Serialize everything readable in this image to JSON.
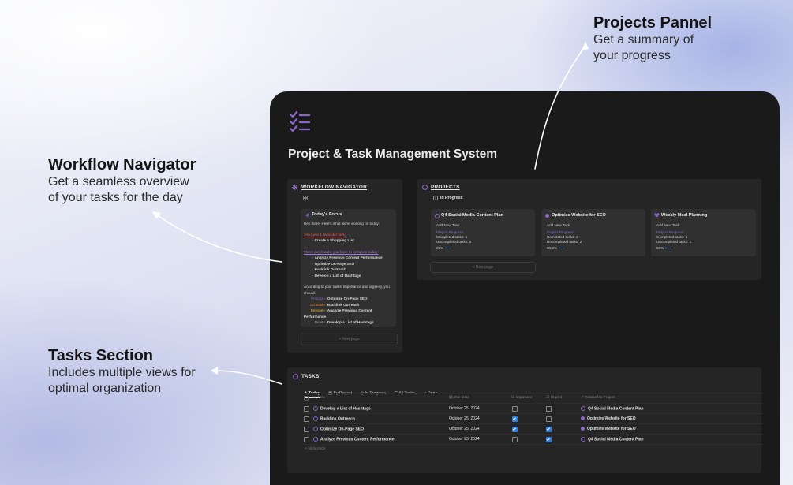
{
  "callouts": {
    "projects": {
      "heading": "Projects Pannel",
      "sub1": "Get a summary of",
      "sub2": "your progress"
    },
    "workflow": {
      "heading": "Workflow Navigator",
      "sub1": "Get a seamless overview",
      "sub2": "of your tasks for the day"
    },
    "tasks": {
      "heading": "Tasks Section",
      "sub1": "Includes multiple views for",
      "sub2": "optimal organization"
    }
  },
  "app": {
    "title": "Project & Task Management System",
    "accent": "#8a66c9"
  },
  "workflow": {
    "header": "WORKFLOW NAVIGATOR",
    "focus_title": "Today's Focus",
    "greeting": "Hey there! Here's what we're working on today:",
    "reminder_link": "You have 1 reminder task:",
    "reminder_item": "Create a Shopping List",
    "tasks_link": "There are 4 tasks you have to complete today:",
    "tasks": [
      "Analyze Previous Content Performance",
      "Optimize On-Page SEO",
      "Backlink Outreach",
      "Develop a List of Hashtags"
    ],
    "advice1": "According to your tasks' importance and urgency, you",
    "advice2": "should:",
    "prioritize_label": "Prioritize",
    "prioritize_item": "Optimize On-Page SEO",
    "schedule_label": "Schedule",
    "schedule_item": "Backlink Outreach",
    "delegate_label": "Delegate",
    "delegate_item": "Analyze Previous Content",
    "delegate_item_cont": "Performance",
    "delete_label": "Delete",
    "delete_item": "Develop a List of Hashtags",
    "new_page": "+ New page"
  },
  "projects": {
    "header": "PROJECTS",
    "view": "In Progress",
    "new_page": "+ New page",
    "cards": [
      {
        "name": "Q4 Social Media Content Plan",
        "add": "Add New Task",
        "progress_label": "Project Progress:",
        "completed": "Completed tasks: 1",
        "uncompleted": "Uncompleted tasks: 3",
        "pct": "25%"
      },
      {
        "name": "Optimize Website for SEO",
        "add": "Add New Task",
        "progress_label": "Project Progress:",
        "completed": "Completed tasks: 1",
        "uncompleted": "Uncompleted tasks: 2",
        "pct": "33.3%"
      },
      {
        "name": "Weekly Meal Planning",
        "add": "Add New Task",
        "progress_label": "Project Progress:",
        "completed": "Completed tasks: 1",
        "uncompleted": "Uncompleted tasks: 1",
        "pct": "50%"
      }
    ]
  },
  "tasks": {
    "header": "TASKS",
    "tabs": [
      "Today",
      "By Project",
      "In Progress",
      "All Tasks",
      "Done"
    ],
    "columns": [
      "Aa Task",
      "Due Date",
      "Important",
      "Urgent",
      "Related to Project"
    ],
    "rows": [
      {
        "task": "Develop a List of Hashtags",
        "due": "October 25, 2024",
        "important": false,
        "urgent": false,
        "project": "Q4 Social Media Content Plan"
      },
      {
        "task": "Backlink Outreach",
        "due": "October 25, 2024",
        "important": true,
        "urgent": false,
        "project": "Optimize Website for SEO"
      },
      {
        "task": "Optimize On-Page SEO",
        "due": "October 25, 2024",
        "important": true,
        "urgent": true,
        "project": "Optimize Website for SEO"
      },
      {
        "task": "Analyze Previous Content Performance",
        "due": "October 25, 2024",
        "important": false,
        "urgent": true,
        "project": "Q4 Social Media Content Plan"
      }
    ],
    "new_page": "+ New page"
  }
}
